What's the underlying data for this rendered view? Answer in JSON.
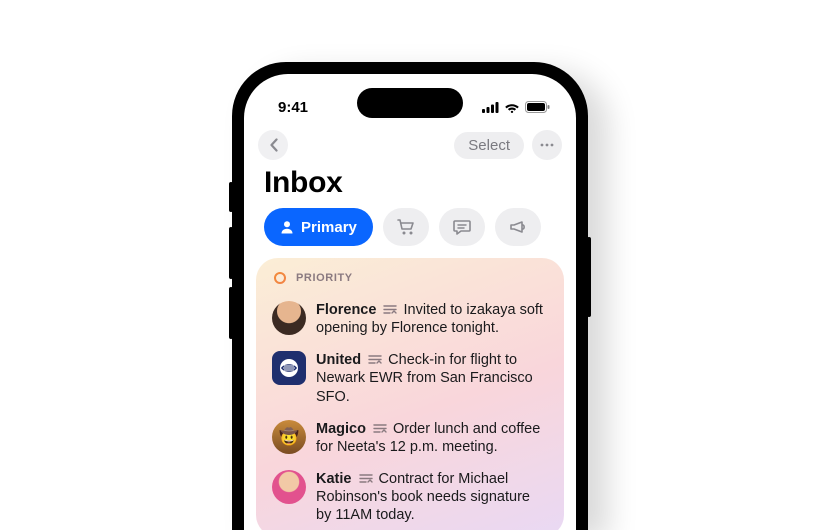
{
  "statusbar": {
    "time": "9:41"
  },
  "nav": {
    "select_label": "Select"
  },
  "page": {
    "title": "Inbox"
  },
  "tabs": {
    "primary_label": "Primary"
  },
  "priority": {
    "heading": "PRIORITY",
    "items": [
      {
        "sender": "Florence",
        "summary": "Invited to izakaya soft opening by Florence tonight."
      },
      {
        "sender": "United",
        "summary": "Check-in for flight to Newark EWR from San Francisco SFO."
      },
      {
        "sender": "Magico",
        "summary": "Order lunch and coffee for Neeta's 12 p.m. meeting."
      },
      {
        "sender": "Katie",
        "summary": "Contract for Michael Robinson's book needs signature by 11AM today."
      }
    ]
  }
}
